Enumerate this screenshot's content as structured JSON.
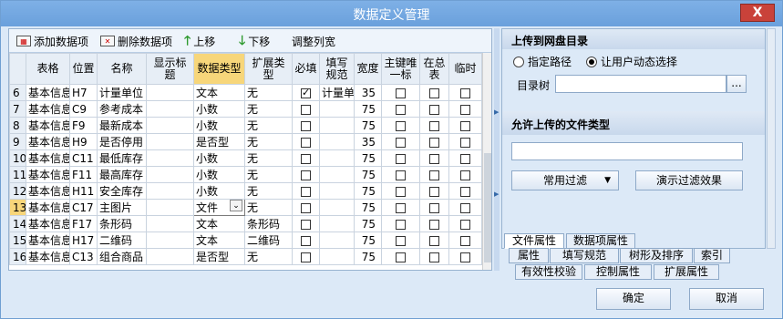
{
  "window": {
    "title": "数据定义管理",
    "close_label": "X"
  },
  "toolbar": {
    "add_label": "添加数据项",
    "delete_label": "删除数据项",
    "up_label": "上移",
    "down_label": "下移",
    "adjust_label": "调整列宽"
  },
  "grid": {
    "headers": [
      "",
      "表格",
      "位置",
      "名称",
      "显示标题",
      "数据类型",
      "扩展类型",
      "必填",
      "填写规范",
      "宽度",
      "主键唯一标",
      "在总表",
      "临时"
    ],
    "rows": [
      {
        "n": "6",
        "table": "基本信息",
        "pos": "H7",
        "name": "计量单位",
        "title": "",
        "type": "文本",
        "ext": "无",
        "req": true,
        "rule": "计量单",
        "width": "35"
      },
      {
        "n": "7",
        "table": "基本信息",
        "pos": "C9",
        "name": "参考成本",
        "title": "",
        "type": "小数",
        "ext": "无",
        "req": false,
        "rule": "",
        "width": "75"
      },
      {
        "n": "8",
        "table": "基本信息",
        "pos": "F9",
        "name": "最新成本",
        "title": "",
        "type": "小数",
        "ext": "无",
        "req": false,
        "rule": "",
        "width": "75"
      },
      {
        "n": "9",
        "table": "基本信息",
        "pos": "H9",
        "name": "是否停用",
        "title": "",
        "type": "是否型",
        "ext": "无",
        "req": false,
        "rule": "",
        "width": "35"
      },
      {
        "n": "10",
        "table": "基本信息",
        "pos": "C11",
        "name": "最低库存",
        "title": "",
        "type": "小数",
        "ext": "无",
        "req": false,
        "rule": "",
        "width": "75"
      },
      {
        "n": "11",
        "table": "基本信息",
        "pos": "F11",
        "name": "最高库存",
        "title": "",
        "type": "小数",
        "ext": "无",
        "req": false,
        "rule": "",
        "width": "75"
      },
      {
        "n": "12",
        "table": "基本信息",
        "pos": "H11",
        "name": "安全库存",
        "title": "",
        "type": "小数",
        "ext": "无",
        "req": false,
        "rule": "",
        "width": "75"
      },
      {
        "n": "13",
        "table": "基本信息",
        "pos": "C17",
        "name": "主图片",
        "title": "",
        "type": "文件",
        "ext": "无",
        "req": false,
        "rule": "",
        "width": "75"
      },
      {
        "n": "14",
        "table": "基本信息",
        "pos": "F17",
        "name": "条形码",
        "title": "",
        "type": "文本",
        "ext": "条形码",
        "req": false,
        "rule": "",
        "width": "75"
      },
      {
        "n": "15",
        "table": "基本信息",
        "pos": "H17",
        "name": "二维码",
        "title": "",
        "type": "文本",
        "ext": "二维码",
        "req": false,
        "rule": "",
        "width": "75"
      },
      {
        "n": "16",
        "table": "基本信息",
        "pos": "C13",
        "name": "组合商品",
        "title": "",
        "type": "是否型",
        "ext": "无",
        "req": false,
        "rule": "",
        "width": "75"
      }
    ]
  },
  "upload": {
    "header": "上传到网盘目录",
    "opt_fixed": "指定路径",
    "opt_user": "让用户动态选择",
    "dir_label": "目录树",
    "dir_value": "",
    "browse_label": "..."
  },
  "filetypes": {
    "header": "允许上传的文件类型",
    "value": "",
    "filter_label": "常用过滤",
    "demo_label": "演示过滤效果"
  },
  "tabs": {
    "row1": [
      "文件属性",
      "数据项属性"
    ],
    "row2": [
      "属性",
      "填写规范",
      "树形及排序",
      "索引"
    ],
    "row3": [
      "有效性校验",
      "控制属性",
      "扩展属性"
    ]
  },
  "footer": {
    "ok_label": "确定",
    "cancel_label": "取消"
  }
}
